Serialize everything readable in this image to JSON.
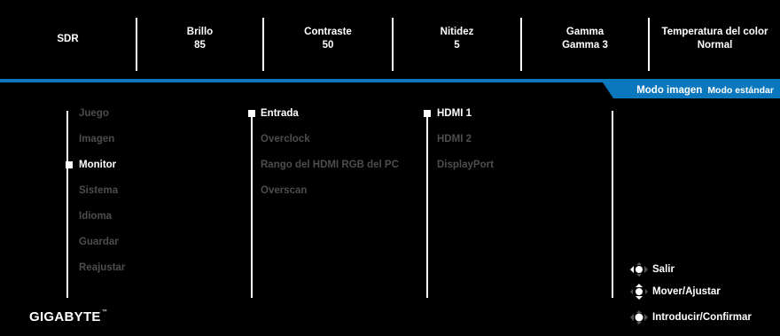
{
  "header": [
    {
      "title": "SDR",
      "value": ""
    },
    {
      "title": "Brillo",
      "value": "85"
    },
    {
      "title": "Contraste",
      "value": "50"
    },
    {
      "title": "Nitidez",
      "value": "5"
    },
    {
      "title": "Gamma",
      "value": "Gamma 3"
    },
    {
      "title": "Temperatura del color",
      "value": "Normal"
    }
  ],
  "mode_tab": {
    "label": "Modo imagen",
    "value": "Modo estándar"
  },
  "menu": {
    "selected_index": 2,
    "items": [
      "Juego",
      "Imagen",
      "Monitor",
      "Sistema",
      "Idioma",
      "Guardar",
      "Reajustar"
    ]
  },
  "submenu": {
    "selected_index": 0,
    "items": [
      "Entrada",
      "Overclock",
      "Rango del HDMI RGB del PC",
      "Overscan"
    ]
  },
  "options": {
    "selected_index": 0,
    "items": [
      "HDMI 1",
      "HDMI 2",
      "DisplayPort"
    ]
  },
  "brand": {
    "name": "GIGABYTE",
    "trademark": "™"
  },
  "controls": [
    {
      "label": "Salir",
      "icon": "joystick-left-icon"
    },
    {
      "label": "Mover/Ajustar",
      "icon": "joystick-updown-icon"
    },
    {
      "label": "Introducir/Confirmar",
      "icon": "joystick-press-icon"
    }
  ],
  "colors": {
    "background": "#000000",
    "accent": "#0b78be",
    "text_active": "#ffffff",
    "text_inactive": "#4d4d4d"
  }
}
